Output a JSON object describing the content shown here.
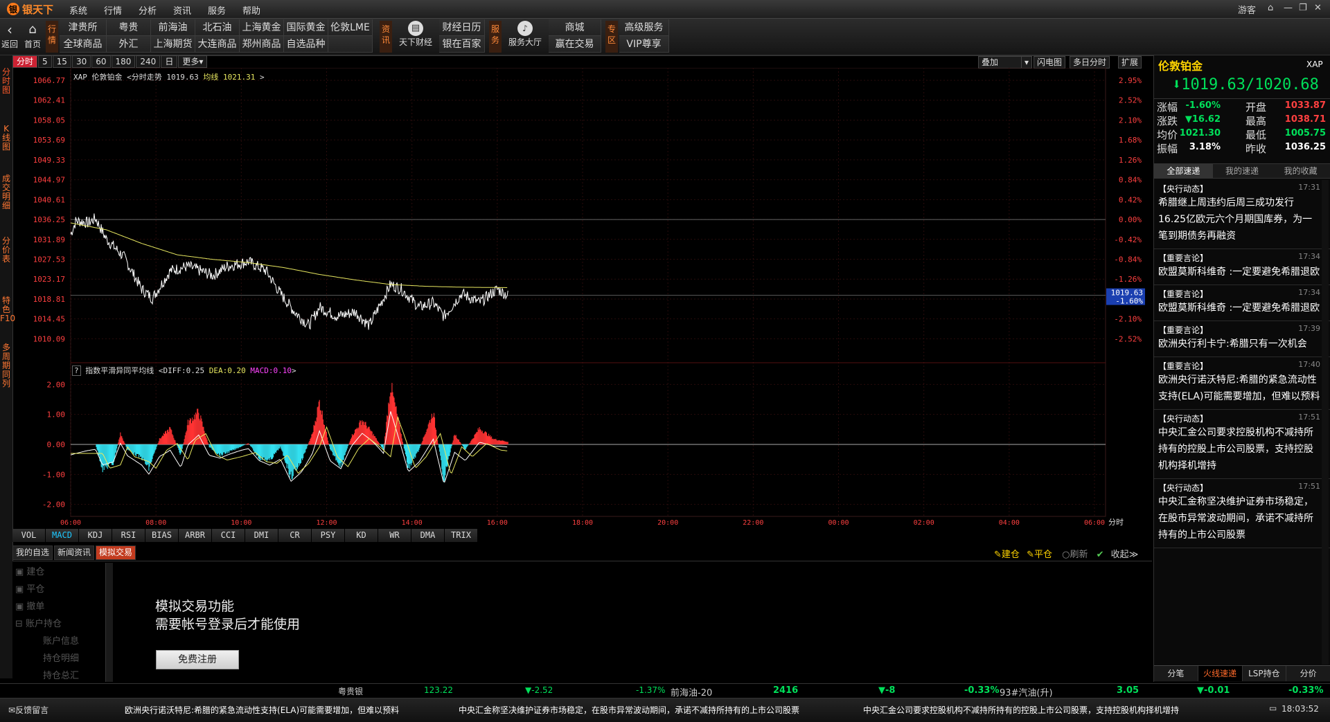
{
  "app": {
    "logo": "银天下",
    "menus": [
      "系统",
      "行情",
      "分析",
      "资讯",
      "服务",
      "帮助"
    ],
    "user": "游客"
  },
  "toolbar": {
    "back": "返回",
    "home": "首页",
    "hangqing_tag": "行情",
    "markets_row1": [
      "津贵所",
      "粤贵",
      "前海油",
      "北石油",
      "上海黄金",
      "国际黄金",
      "伦敦LME"
    ],
    "markets_row2": [
      "全球商品",
      "外汇",
      "上海期货",
      "大连商品",
      "郑州商品",
      "自选品种"
    ],
    "zixun_tag": "资讯",
    "tianxia": "天下财经",
    "caijing_calendar": "财经日历",
    "yinshi": "银在百家",
    "fuwu_tag": "服务",
    "service_hall": "服务大厅",
    "shop": "商城",
    "win_trade": "赢在交易",
    "zhuanqu_tag": "专区",
    "premium": "高级服务",
    "vip": "VIP尊享"
  },
  "sidetabs": [
    "分时图",
    "K线图",
    "成交明细",
    "分价表",
    "特色F10",
    "多周期同列"
  ],
  "periods": [
    "分时",
    "5",
    "15",
    "30",
    "60",
    "180",
    "240",
    "日",
    "更多▾"
  ],
  "chart_controls": {
    "overlay": "叠加",
    "flash": "闪电图",
    "multi_day": "多日分时",
    "expand": "扩展"
  },
  "chart_header": {
    "code": "XAP",
    "name": "伦敦铂金",
    "kind": "分时走势",
    "last": "1019.63",
    "avg_label": "均线",
    "avg": "1021.31"
  },
  "macd_header": {
    "name": "指数平滑异同平均线",
    "diff": "DIFF:0.25",
    "dea": "DEA:0.20",
    "macd": "MACD:0.10"
  },
  "chart_data": {
    "type": "line",
    "price_ticks": [
      "1066.77",
      "1062.41",
      "1058.05",
      "1053.69",
      "1049.33",
      "1044.97",
      "1040.61",
      "1036.25",
      "1031.89",
      "1027.53",
      "1023.17",
      "1018.81",
      "1014.45",
      "1010.09"
    ],
    "pct_ticks": [
      "2.95%",
      "2.52%",
      "2.10%",
      "1.68%",
      "1.26%",
      "0.84%",
      "0.42%",
      "0.00%",
      "-0.42%",
      "-0.84%",
      "-1.26%",
      "-1.68%",
      "-2.10%",
      "-2.52%"
    ],
    "time_ticks": [
      "06:00",
      "08:00",
      "10:00",
      "12:00",
      "14:00",
      "16:00",
      "18:00",
      "20:00",
      "22:00",
      "00:00",
      "02:00",
      "04:00",
      "06:00"
    ],
    "time_unit": "分时",
    "macd_ticks": [
      "2.00",
      "1.00",
      "0.00",
      "-1.00",
      "-2.00"
    ],
    "ylim": [
      1005.75,
      1066.77
    ],
    "prev_close": 1036.25,
    "current_tag": [
      "1019.63",
      "-1.60%"
    ],
    "price_keypoints": [
      [
        0,
        1033
      ],
      [
        3,
        1036
      ],
      [
        10,
        1035.5
      ],
      [
        14,
        1036.5
      ],
      [
        20,
        1032
      ],
      [
        30,
        1028
      ],
      [
        40,
        1021
      ],
      [
        46,
        1019
      ],
      [
        56,
        1025
      ],
      [
        66,
        1026
      ],
      [
        80,
        1024
      ],
      [
        88,
        1026
      ],
      [
        100,
        1027
      ],
      [
        110,
        1025
      ],
      [
        118,
        1020
      ],
      [
        126,
        1016
      ],
      [
        134,
        1013
      ],
      [
        140,
        1017
      ],
      [
        150,
        1015
      ],
      [
        160,
        1016
      ],
      [
        168,
        1013
      ],
      [
        176,
        1019
      ],
      [
        180,
        1022
      ],
      [
        186,
        1021
      ],
      [
        196,
        1017
      ],
      [
        204,
        1018
      ],
      [
        210,
        1015
      ],
      [
        220,
        1020
      ],
      [
        230,
        1018
      ],
      [
        240,
        1021
      ],
      [
        246,
        1019.6
      ]
    ],
    "avg_keypoints": [
      [
        0,
        1035.5
      ],
      [
        20,
        1034
      ],
      [
        40,
        1031
      ],
      [
        60,
        1028.5
      ],
      [
        80,
        1027.5
      ],
      [
        100,
        1026.8
      ],
      [
        120,
        1025.7
      ],
      [
        140,
        1024.2
      ],
      [
        160,
        1023
      ],
      [
        180,
        1022
      ],
      [
        200,
        1021.6
      ],
      [
        220,
        1021.4
      ],
      [
        246,
        1021.31
      ]
    ],
    "macd_keypoints": [
      [
        0,
        0
      ],
      [
        14,
        0
      ],
      [
        18,
        -0.9
      ],
      [
        24,
        -0.7
      ],
      [
        28,
        0.4
      ],
      [
        32,
        -0.2
      ],
      [
        40,
        -0.5
      ],
      [
        44,
        -0.9
      ],
      [
        50,
        0.2
      ],
      [
        56,
        0.6
      ],
      [
        62,
        -0.4
      ],
      [
        66,
        0.8
      ],
      [
        72,
        1.2
      ],
      [
        78,
        -0.1
      ],
      [
        84,
        -0.4
      ],
      [
        92,
        -0.2
      ],
      [
        100,
        0.05
      ],
      [
        106,
        -0.5
      ],
      [
        112,
        -0.6
      ],
      [
        118,
        -0.1
      ],
      [
        124,
        -1.2
      ],
      [
        130,
        -0.6
      ],
      [
        136,
        0.4
      ],
      [
        140,
        1.6
      ],
      [
        146,
        -0.2
      ],
      [
        152,
        -0.8
      ],
      [
        158,
        0.3
      ],
      [
        164,
        0.9
      ],
      [
        170,
        0.4
      ],
      [
        176,
        -0.2
      ],
      [
        180,
        2.2
      ],
      [
        184,
        1.0
      ],
      [
        190,
        -0.9
      ],
      [
        196,
        -0.2
      ],
      [
        204,
        1.2
      ],
      [
        210,
        -1.3
      ],
      [
        216,
        0.4
      ],
      [
        222,
        -0.2
      ],
      [
        230,
        0.6
      ],
      [
        238,
        0.2
      ],
      [
        246,
        0.1
      ]
    ]
  },
  "quote": {
    "name": "伦敦铂金",
    "code": "XAP",
    "price": "1019.63/1020.68",
    "rows": [
      [
        "涨幅",
        "-1.60%",
        "开盘",
        "1033.87"
      ],
      [
        "涨跌",
        "16.62",
        "最高",
        "1038.71"
      ],
      [
        "均价",
        "1021.30",
        "最低",
        "1005.75"
      ],
      [
        "振幅",
        "3.18%",
        "昨收",
        "1036.25"
      ]
    ],
    "colors": {
      "down": "#00e05a",
      "up": "#ff4040",
      "yellow": "#ffd400"
    }
  },
  "news_tabs": [
    "全部速递",
    "我的速递",
    "我的收藏"
  ],
  "news": [
    {
      "cat": "【央行动态】",
      "time": "17:31",
      "text": "希腊继上周违约后周三成功发行16.25亿欧元六个月期国库券，为一笔到期债务再融资"
    },
    {
      "cat": "【重要言论】",
      "time": "17:34",
      "text": "欧盟莫斯科维奇 :一定要避免希腊退欧"
    },
    {
      "cat": "【重要言论】",
      "time": "17:34",
      "text": "欧盟莫斯科维奇 :一定要避免希腊退欧"
    },
    {
      "cat": "【重要言论】",
      "time": "17:39",
      "text": "欧洲央行利卡宁:希腊只有一次机会"
    },
    {
      "cat": "【重要言论】",
      "time": "17:40",
      "text": "欧洲央行诺沃特尼:希腊的紧急流动性支持(ELA)可能需要增加，但难以预料"
    },
    {
      "cat": "【央行动态】",
      "time": "17:51",
      "text": "中央汇金公司要求控股机构不减持所持有的控股上市公司股票，支持控股机构择机增持"
    },
    {
      "cat": "【央行动态】",
      "time": "17:51",
      "text": "中央汇金称坚决维护证券市场稳定，在股市异常波动期间，承诺不减持所持有的上市公司股票"
    }
  ],
  "right_bottom_tabs": [
    "分笔",
    "火线速递",
    "LSP持仓",
    "分价"
  ],
  "indicators": [
    "VOL",
    "MACD",
    "KDJ",
    "RSI",
    "BIAS",
    "ARBR",
    "CCI",
    "DMI",
    "CR",
    "PSY",
    "KD",
    "WR",
    "DMA",
    "TRIX"
  ],
  "bottom_tabs": [
    "我的自选",
    "新闻资讯",
    "模拟交易"
  ],
  "bottom_actions": {
    "open": "建仓",
    "close": "平仓",
    "refresh": "刷新",
    "collapse": "收起"
  },
  "tree": [
    "建仓",
    "平仓",
    "撤单",
    "账户持仓",
    "账户信息",
    "持仓明细",
    "持仓总汇"
  ],
  "sim_trade": {
    "line1": "模拟交易功能",
    "line2": "需要帐号登录后才能使用",
    "register": "免费注册"
  },
  "quote_strip": [
    {
      "name": "粤贵银",
      "price": "123.22",
      "change": "-2.52",
      "pct": "-1.37%"
    },
    {
      "name": "前海油-20",
      "price": "2416",
      "change": "-8",
      "pct": "-0.33%"
    },
    {
      "name": "93#汽油(升)",
      "price": "3.05",
      "change": "-0.01",
      "pct": "-0.33%"
    }
  ],
  "ticker": {
    "feedback": "反馈留言",
    "items": [
      "欧洲央行诺沃特尼:希腊的紧急流动性支持(ELA)可能需要增加，但难以预料",
      "中央汇金称坚决维护证券市场稳定，在股市异常波动期间，承诺不减持所持有的上市公司股票",
      "中央汇金公司要求控股机构不减持所持有的控股上市公司股票，支持控股机构择机增持"
    ],
    "clock": "18:03:52"
  }
}
